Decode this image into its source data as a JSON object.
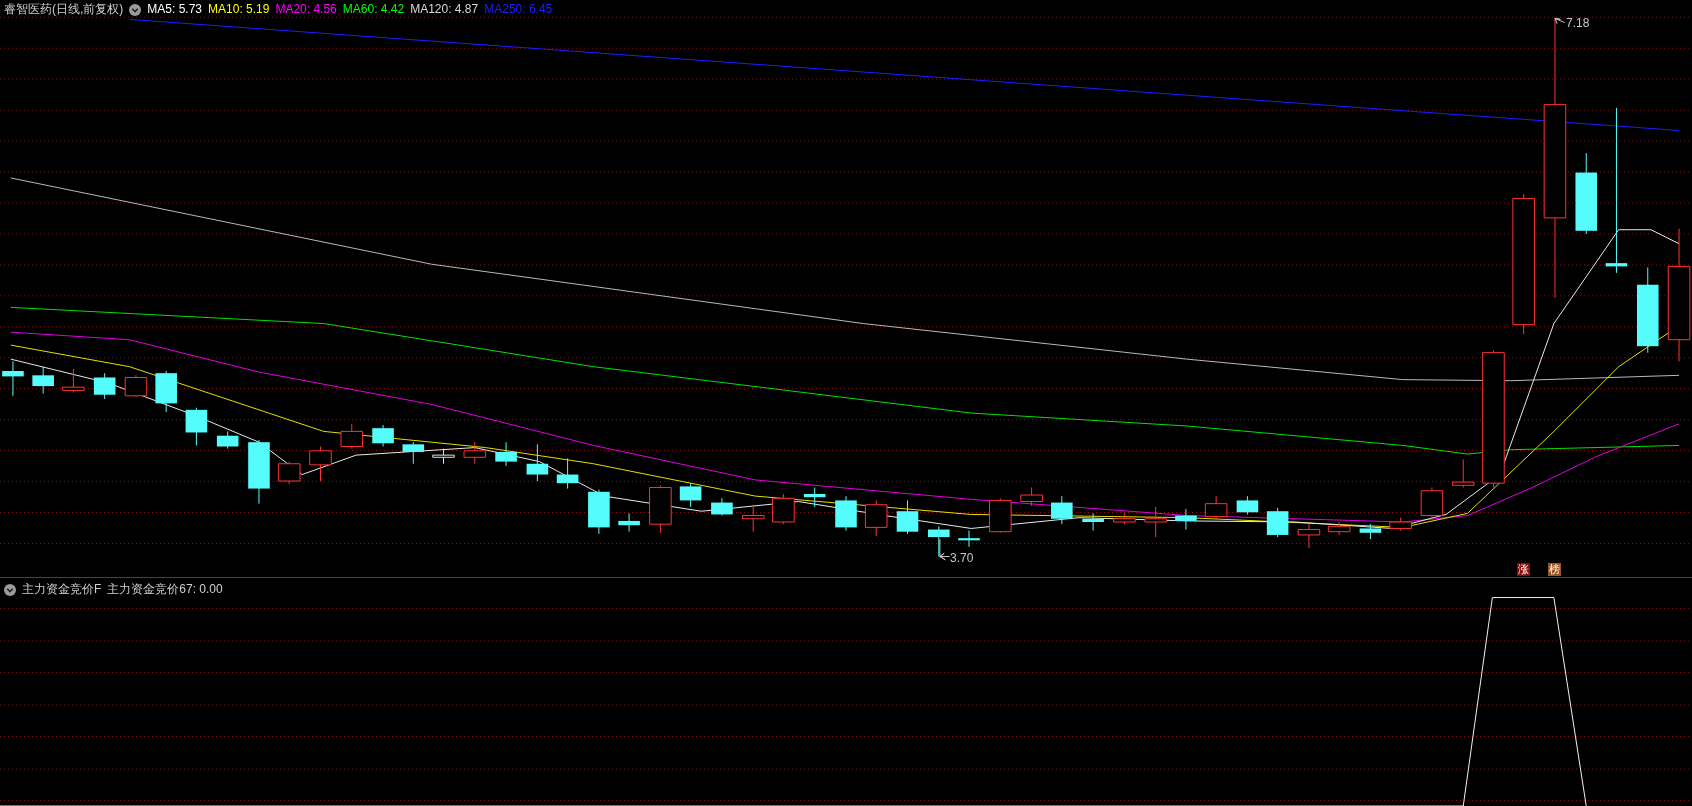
{
  "price_panel": {
    "title": "睿智医药(日线,前复权)",
    "moving_averages": [
      {
        "label": "MA5: 5.73",
        "color": "#ffffff"
      },
      {
        "label": "MA10: 5.19",
        "color": "#ffff00"
      },
      {
        "label": "MA20: 4.56",
        "color": "#ff00ff"
      },
      {
        "label": "MA60: 4.42",
        "color": "#00ff00"
      },
      {
        "label": "MA120: 4.87",
        "color": "#d8d8d8"
      },
      {
        "label": "MA250: 6.45",
        "color": "#1e1eff"
      }
    ],
    "high_label": "7.18",
    "low_label": "3.70",
    "badges": [
      {
        "text": "涨",
        "color": "#8b0a0a"
      },
      {
        "text": "榜",
        "color": "#a0521e"
      }
    ]
  },
  "indicator_panel": {
    "name": "主力资金竞价F",
    "reading": "主力资金竞价67: 0.00"
  }
}
